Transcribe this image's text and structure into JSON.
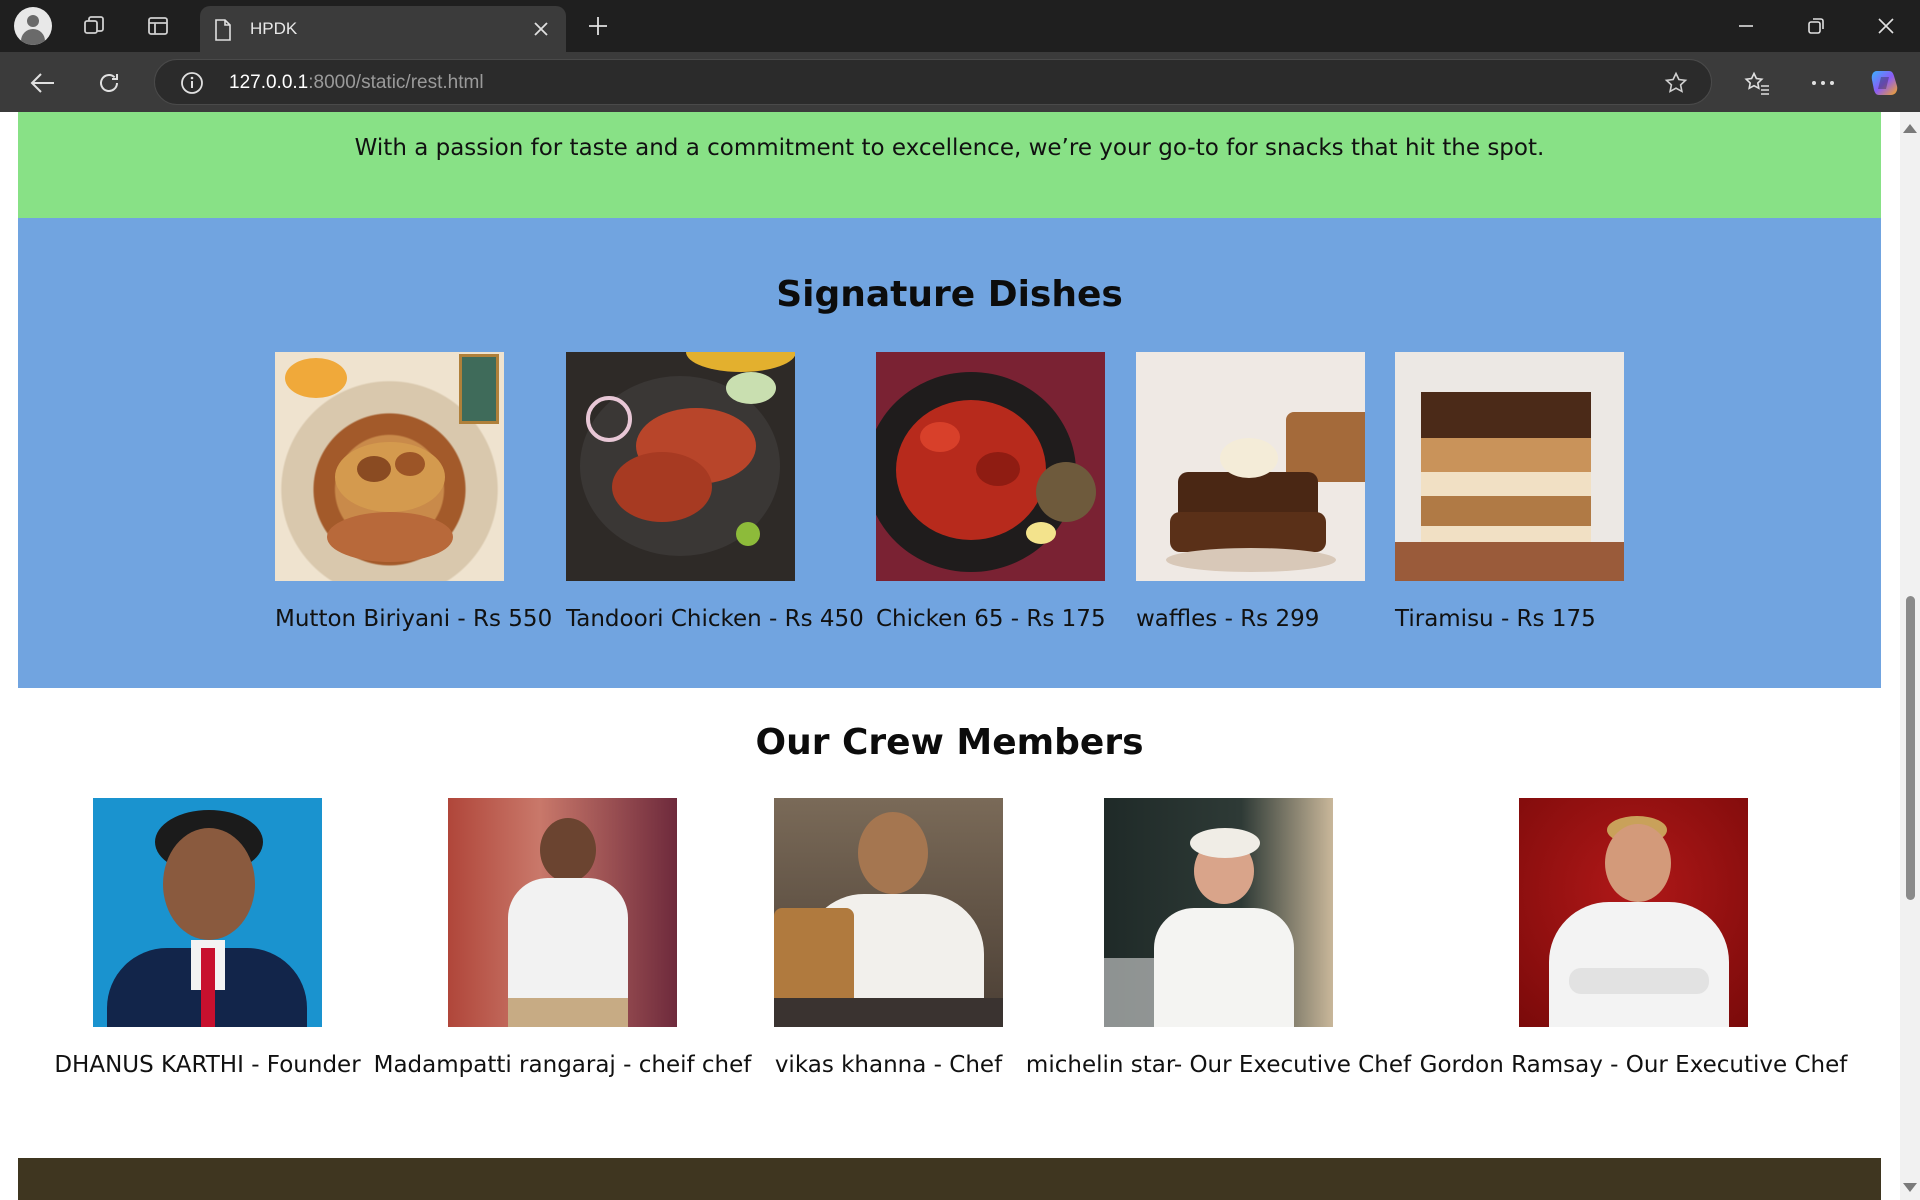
{
  "browser": {
    "tab_title": "HPDK",
    "url_host": "127.0.0.1",
    "url_rest": ":8000/static/rest.html"
  },
  "banner": {
    "text": "With a passion for taste and a commitment to excellence, we’re your go-to for snacks that hit the spot."
  },
  "dishes": {
    "title": "Signature Dishes",
    "items": [
      {
        "caption": "Mutton Biriyani - Rs 550"
      },
      {
        "caption": "Tandoori Chicken - Rs 450"
      },
      {
        "caption": "Chicken 65 - Rs 175"
      },
      {
        "caption": "waffles - Rs 299"
      },
      {
        "caption": "Tiramisu - Rs 175"
      }
    ]
  },
  "crew": {
    "title": "Our Crew Members",
    "members": [
      {
        "caption": "DHANUS KARTHI - Founder"
      },
      {
        "caption": "Madampatti rangaraj - cheif chef"
      },
      {
        "caption": "vikas khanna - Chef"
      },
      {
        "caption": "michelin star- Our Executive Chef"
      },
      {
        "caption": "Gordon Ramsay - Our Executive Chef"
      }
    ]
  },
  "colors": {
    "banner_bg": "#88e186",
    "dishes_bg": "#71a4e0",
    "footer_bg": "#3f3620"
  }
}
